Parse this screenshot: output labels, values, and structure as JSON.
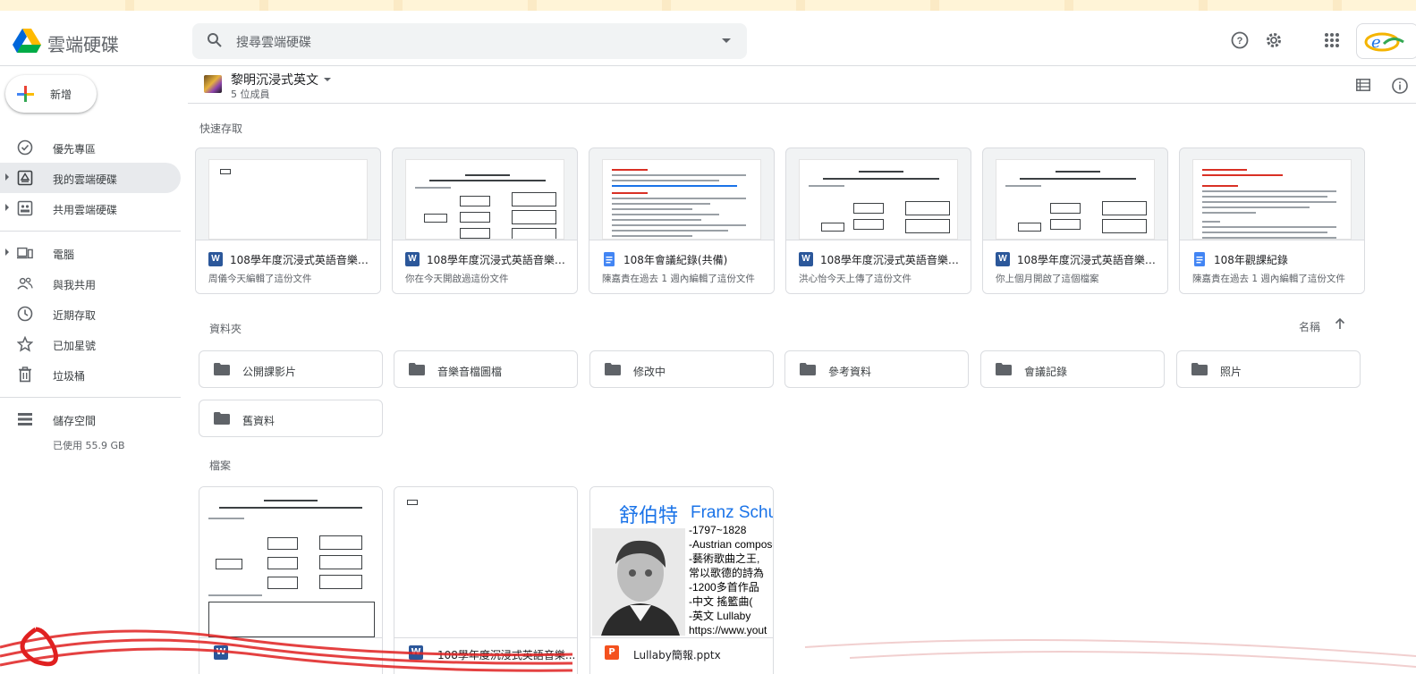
{
  "app": {
    "brand": "雲端硬碟"
  },
  "search": {
    "placeholder": "搜尋雲端硬碟"
  },
  "sidebar": {
    "new_label": "新增",
    "items": [
      {
        "label": "優先專區",
        "icon": "priority-icon"
      },
      {
        "label": "我的雲端硬碟",
        "icon": "my-drive-icon",
        "active": true
      },
      {
        "label": "共用雲端硬碟",
        "icon": "shared-drive-icon"
      },
      {
        "label": "電腦",
        "icon": "computer-icon"
      },
      {
        "label": "與我共用",
        "icon": "people-icon"
      },
      {
        "label": "近期存取",
        "icon": "clock-icon"
      },
      {
        "label": "已加星號",
        "icon": "star-icon"
      },
      {
        "label": "垃圾桶",
        "icon": "trash-icon"
      }
    ],
    "storage": {
      "label": "儲存空間",
      "used": "已使用 55.9 GB"
    }
  },
  "shared_drive": {
    "name": "黎明沉浸式英文",
    "members": "5 位成員"
  },
  "sections": {
    "quick_access": "快速存取",
    "folders": "資料夾",
    "files": "檔案",
    "sort_label": "名稱"
  },
  "quick_access": [
    {
      "name": "108學年度沉浸式英語音樂教...",
      "desc": "周儀今天編輯了這份文件",
      "type": "word"
    },
    {
      "name": "108學年度沉浸式英語音樂教...",
      "desc": "你在今天開啟過這份文件",
      "type": "word"
    },
    {
      "name": "108年會議紀錄(共備)",
      "desc": "陳嘉貴在過去 1 週內編輯了這份文件",
      "type": "doc"
    },
    {
      "name": "108學年度沉浸式英語音樂教...",
      "desc": "洪心怡今天上傳了這份文件",
      "type": "word"
    },
    {
      "name": "108學年度沉浸式英語音樂教...",
      "desc": "你上個月開啟了這個檔案",
      "type": "word"
    },
    {
      "name": "108年觀課紀錄",
      "desc": "陳嘉貴在過去 1 週內編輯了這份文件",
      "type": "doc"
    }
  ],
  "folders": [
    "公開課影片",
    "音樂音檔圖檔",
    "修改中",
    "參考資料",
    "會議記錄",
    "照片",
    "舊資料"
  ],
  "files": [
    {
      "name": "",
      "type": "word"
    },
    {
      "name": "108學年度沉浸式英語音樂...",
      "type": "word"
    },
    {
      "name": "Lullaby簡報.pptx",
      "type": "pptx"
    }
  ],
  "schubert_slide": {
    "title_cn": "舒伯特",
    "title_en": "Franz Schu",
    "lines": [
      "-1797~1828",
      "-Austrian compose",
      "-藝術歌曲之王,",
      " 常以歌德的詩為",
      "-1200多首作品",
      "-中文 搖籃曲(",
      "-英文 Lullaby",
      "https://www.yout"
    ]
  },
  "colors": {
    "word": "#2b579a",
    "docs": "#4285f4",
    "slides": "#f4511e",
    "folder": "#5f6368"
  }
}
